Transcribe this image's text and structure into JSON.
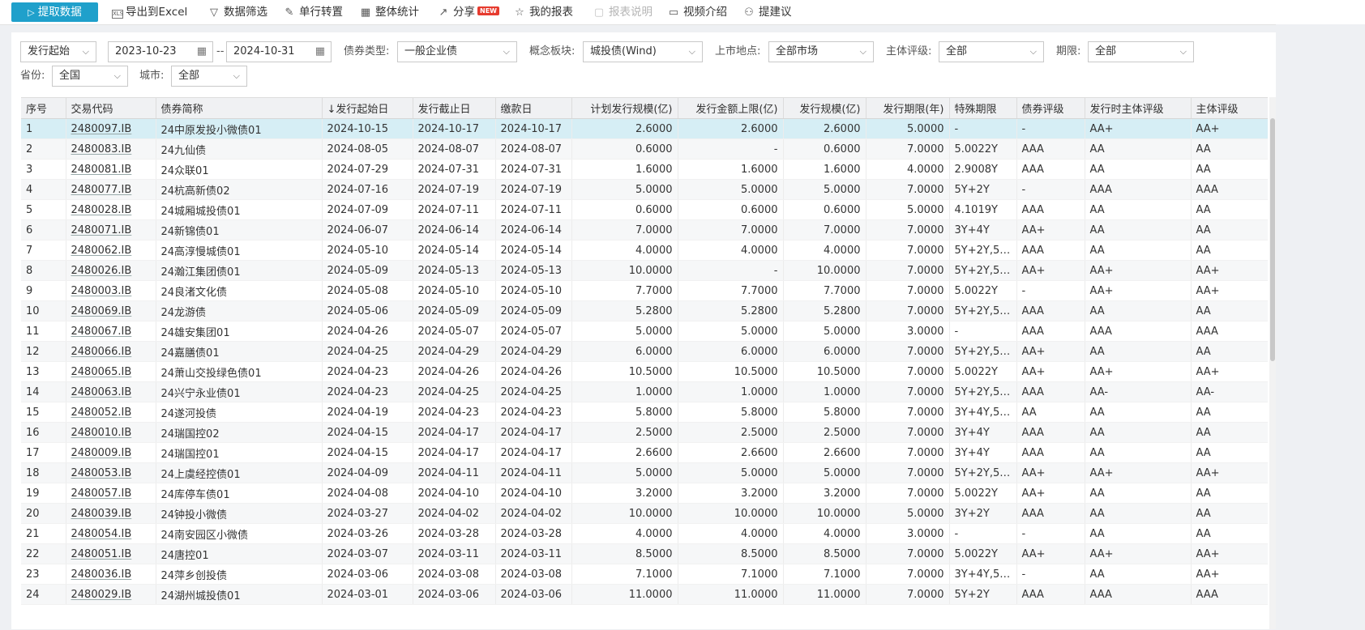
{
  "toolbar": {
    "fetch": "提取数据",
    "excel": "导出到Excel",
    "excel_icon_text": "XLS",
    "filter": "数据筛选",
    "row_transpose": "单行转置",
    "overall_stats": "整体统计",
    "share": "分享",
    "new_badge": "NEW",
    "my_reports": "我的报表",
    "report_desc": "报表说明",
    "video": "视频介绍",
    "suggest": "提建议"
  },
  "filters": {
    "date_type": "发行起始",
    "date_from": "2023-10-23",
    "date_sep": "--",
    "date_to": "2024-10-31",
    "bond_type_label": "债券类型:",
    "bond_type": "一般企业债",
    "concept_label": "概念板块:",
    "concept": "城投债(Wind)",
    "market_label": "上市地点:",
    "market": "全部市场",
    "rating_label": "主体评级:",
    "rating": "全部",
    "term_label": "期限:",
    "term": "全部",
    "province_label": "省份:",
    "province": "全国",
    "city_label": "城市:",
    "city": "全部"
  },
  "table": {
    "columns": [
      "序号",
      "交易代码",
      "债券简称",
      "↓发行起始日",
      "发行截止日",
      "缴款日",
      "计划发行规模(亿)",
      "发行金额上限(亿)",
      "发行规模(亿)",
      "发行期限(年)",
      "特殊期限",
      "债券评级",
      "发行时主体评级",
      "主体评级"
    ],
    "rows": [
      [
        "1",
        "2480097.IB",
        "24中原发投小微债01",
        "2024-10-15",
        "2024-10-17",
        "2024-10-17",
        "2.6000",
        "2.6000",
        "2.6000",
        "5.0000",
        "-",
        "-",
        "AA+",
        "AA+"
      ],
      [
        "2",
        "2480083.IB",
        "24九仙债",
        "2024-08-05",
        "2024-08-07",
        "2024-08-07",
        "0.6000",
        "-",
        "0.6000",
        "7.0000",
        "5.0022Y",
        "AAA",
        "AA",
        "AA"
      ],
      [
        "3",
        "2480081.IB",
        "24众联01",
        "2024-07-29",
        "2024-07-31",
        "2024-07-31",
        "1.6000",
        "1.6000",
        "1.6000",
        "4.0000",
        "2.9008Y",
        "AAA",
        "AA",
        "AA"
      ],
      [
        "4",
        "2480077.IB",
        "24杭高新债02",
        "2024-07-16",
        "2024-07-19",
        "2024-07-19",
        "5.0000",
        "5.0000",
        "5.0000",
        "7.0000",
        "5Y+2Y",
        "-",
        "AAA",
        "AAA"
      ],
      [
        "5",
        "2480028.IB",
        "24城厢城投债01",
        "2024-07-09",
        "2024-07-11",
        "2024-07-11",
        "0.6000",
        "0.6000",
        "0.6000",
        "5.0000",
        "4.1019Y",
        "AAA",
        "AA",
        "AA"
      ],
      [
        "6",
        "2480071.IB",
        "24新锦债01",
        "2024-06-07",
        "2024-06-14",
        "2024-06-14",
        "7.0000",
        "7.0000",
        "7.0000",
        "7.0000",
        "3Y+4Y",
        "AA+",
        "AA",
        "AA"
      ],
      [
        "7",
        "2480062.IB",
        "24高淳慢城债01",
        "2024-05-10",
        "2024-05-14",
        "2024-05-14",
        "4.0000",
        "4.0000",
        "4.0000",
        "7.0000",
        "5Y+2Y,5....",
        "AAA",
        "AA",
        "AA"
      ],
      [
        "8",
        "2480026.IB",
        "24瀚江集团债01",
        "2024-05-09",
        "2024-05-13",
        "2024-05-13",
        "10.0000",
        "-",
        "10.0000",
        "7.0000",
        "5Y+2Y,5....",
        "AA+",
        "AA+",
        "AA+"
      ],
      [
        "9",
        "2480003.IB",
        "24良渚文化债",
        "2024-05-08",
        "2024-05-10",
        "2024-05-10",
        "7.7000",
        "7.7000",
        "7.7000",
        "7.0000",
        "5.0022Y",
        "-",
        "AA+",
        "AA+"
      ],
      [
        "10",
        "2480069.IB",
        "24龙游债",
        "2024-05-06",
        "2024-05-09",
        "2024-05-09",
        "5.2800",
        "5.2800",
        "5.2800",
        "7.0000",
        "5Y+2Y,5....",
        "AAA",
        "AA",
        "AA"
      ],
      [
        "11",
        "2480067.IB",
        "24雄安集团01",
        "2024-04-26",
        "2024-05-07",
        "2024-05-07",
        "5.0000",
        "5.0000",
        "5.0000",
        "3.0000",
        "-",
        "AAA",
        "AAA",
        "AAA"
      ],
      [
        "12",
        "2480066.IB",
        "24嘉膳债01",
        "2024-04-25",
        "2024-04-29",
        "2024-04-29",
        "6.0000",
        "6.0000",
        "6.0000",
        "7.0000",
        "5Y+2Y,5....",
        "AA+",
        "AA",
        "AA"
      ],
      [
        "13",
        "2480065.IB",
        "24萧山交投绿色债01",
        "2024-04-23",
        "2024-04-26",
        "2024-04-26",
        "10.5000",
        "10.5000",
        "10.5000",
        "7.0000",
        "5.0022Y",
        "AA+",
        "AA+",
        "AA+"
      ],
      [
        "14",
        "2480063.IB",
        "24兴宁永业债01",
        "2024-04-23",
        "2024-04-25",
        "2024-04-25",
        "1.0000",
        "1.0000",
        "1.0000",
        "7.0000",
        "5Y+2Y,5....",
        "AAA",
        "AA-",
        "AA-"
      ],
      [
        "15",
        "2480052.IB",
        "24遂河投债",
        "2024-04-19",
        "2024-04-23",
        "2024-04-23",
        "5.8000",
        "5.8000",
        "5.8000",
        "7.0000",
        "3Y+4Y,5....",
        "AA",
        "AA",
        "AA"
      ],
      [
        "16",
        "2480010.IB",
        "24瑞国控02",
        "2024-04-15",
        "2024-04-17",
        "2024-04-17",
        "2.5000",
        "2.5000",
        "2.5000",
        "7.0000",
        "3Y+4Y",
        "AAA",
        "AA",
        "AA"
      ],
      [
        "17",
        "2480009.IB",
        "24瑞国控01",
        "2024-04-15",
        "2024-04-17",
        "2024-04-17",
        "2.6600",
        "2.6600",
        "2.6600",
        "7.0000",
        "3Y+4Y",
        "AAA",
        "AA",
        "AA"
      ],
      [
        "18",
        "2480053.IB",
        "24上虞经控债01",
        "2024-04-09",
        "2024-04-11",
        "2024-04-11",
        "5.0000",
        "5.0000",
        "5.0000",
        "7.0000",
        "5Y+2Y,5....",
        "AA+",
        "AA+",
        "AA+"
      ],
      [
        "19",
        "2480057.IB",
        "24库停车债01",
        "2024-04-08",
        "2024-04-10",
        "2024-04-10",
        "3.2000",
        "3.2000",
        "3.2000",
        "7.0000",
        "5.0022Y",
        "AA+",
        "AA",
        "AA"
      ],
      [
        "20",
        "2480039.IB",
        "24钟投小微债",
        "2024-03-27",
        "2024-04-02",
        "2024-04-02",
        "10.0000",
        "10.0000",
        "10.0000",
        "5.0000",
        "3Y+2Y",
        "AAA",
        "AA",
        "AA"
      ],
      [
        "21",
        "2480054.IB",
        "24南安园区小微债",
        "2024-03-26",
        "2024-03-28",
        "2024-03-28",
        "4.0000",
        "4.0000",
        "4.0000",
        "3.0000",
        "-",
        "-",
        "AA",
        "AA"
      ],
      [
        "22",
        "2480051.IB",
        "24唐控01",
        "2024-03-07",
        "2024-03-11",
        "2024-03-11",
        "8.5000",
        "8.5000",
        "8.5000",
        "7.0000",
        "5.0022Y",
        "AA+",
        "AA+",
        "AA+"
      ],
      [
        "23",
        "2480036.IB",
        "24萍乡创投债",
        "2024-03-06",
        "2024-03-08",
        "2024-03-08",
        "7.1000",
        "7.1000",
        "7.1000",
        "7.0000",
        "3Y+4Y,5....",
        "-",
        "AA",
        "AA+"
      ],
      [
        "24",
        "2480029.IB",
        "24湖州城投债01",
        "2024-03-01",
        "2024-03-06",
        "2024-03-06",
        "11.0000",
        "11.0000",
        "11.0000",
        "7.0000",
        "5Y+2Y",
        "AAA",
        "AAA",
        "AAA"
      ]
    ]
  }
}
